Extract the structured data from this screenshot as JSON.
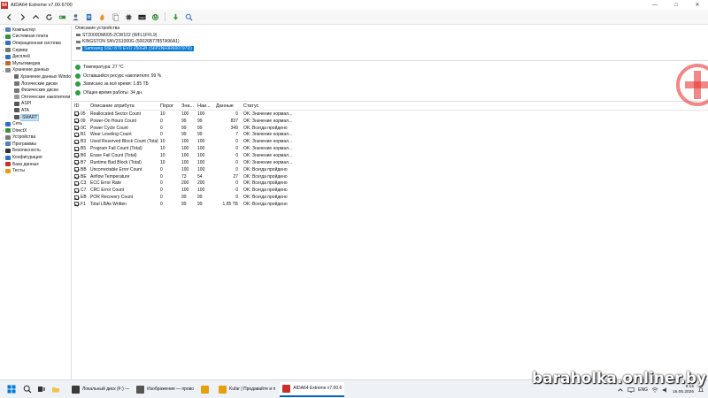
{
  "window": {
    "title": "AIDA64 Extreme v7.00.6700",
    "logo_text": "64"
  },
  "toolbar": {
    "buttons": [
      "back-icon",
      "forward-icon",
      "up-icon",
      "refresh-icon",
      "motherboard-icon",
      "user-icon",
      "report-icon",
      "favorites-icon",
      "folder-icon",
      "chip-icon",
      "osd-icon",
      "power-icon",
      "download-icon",
      "search-icon"
    ]
  },
  "sidebar": {
    "items": [
      {
        "label": "Компьютер",
        "exp": ">",
        "indent": 0
      },
      {
        "label": "Системная плата",
        "exp": ">",
        "indent": 0
      },
      {
        "label": "Операционная система",
        "exp": ">",
        "indent": 0
      },
      {
        "label": "Сервер",
        "exp": ">",
        "indent": 0
      },
      {
        "label": "Дисплей",
        "exp": ">",
        "indent": 0
      },
      {
        "label": "Мультимедиа",
        "exp": ">",
        "indent": 0
      },
      {
        "label": "Хранение данных",
        "exp": "v",
        "indent": 0
      },
      {
        "label": "Хранение данных Windo",
        "exp": "",
        "indent": 1
      },
      {
        "label": "Логические диски",
        "exp": "",
        "indent": 1
      },
      {
        "label": "Физические диски",
        "exp": "",
        "indent": 1
      },
      {
        "label": "Оптические накопители",
        "exp": "",
        "indent": 1
      },
      {
        "label": "ASPI",
        "exp": "",
        "indent": 1
      },
      {
        "label": "ATA",
        "exp": "",
        "indent": 1
      },
      {
        "label": "SMART",
        "exp": "",
        "indent": 1,
        "selected": true
      },
      {
        "label": "Сеть",
        "exp": ">",
        "indent": 0
      },
      {
        "label": "DirectX",
        "exp": ">",
        "indent": 0
      },
      {
        "label": "Устройства",
        "exp": ">",
        "indent": 0
      },
      {
        "label": "Программы",
        "exp": ">",
        "indent": 0
      },
      {
        "label": "Безопасность",
        "exp": ">",
        "indent": 0
      },
      {
        "label": "Конфигурация",
        "exp": ">",
        "indent": 0
      },
      {
        "label": "База данных",
        "exp": ">",
        "indent": 0
      },
      {
        "label": "Тесты",
        "exp": ">",
        "indent": 0
      }
    ]
  },
  "devices": {
    "header": "Описание устройства",
    "items": [
      {
        "label": "ST2000DM005-2CW102 (WFL1FFL9)",
        "selected": false
      },
      {
        "label": "KINGSTON SNV2S1000G (50026B7785TA96A1)",
        "selected": false
      },
      {
        "label": "Samsung SSD 870 EVO 250GB (S6P2NF0R600797D)",
        "selected": true
      }
    ]
  },
  "info": [
    "Температура: 27 °C",
    "Оставшийся ресурс накопителя: 99 %",
    "Записано за всё время: 1.85 ТБ",
    "Общее время работы: 34 дн."
  ],
  "table": {
    "headers": {
      "id": "ID",
      "desc": "Описание атрибута",
      "thr": "Порог",
      "val": "Зна...",
      "worst": "Наи...",
      "data": "Данные",
      "status": "Статус"
    },
    "rows": [
      {
        "id": "05",
        "desc": "Reallocated Sector Count",
        "thr": "10",
        "val": "100",
        "worst": "100",
        "data": "0",
        "status": "OK: Значение нормал..."
      },
      {
        "id": "09",
        "desc": "Power-On Hours Count",
        "thr": "0",
        "val": "99",
        "worst": "99",
        "data": "837",
        "status": "OK: Значение нормал..."
      },
      {
        "id": "0C",
        "desc": "Power Cycle Count",
        "thr": "0",
        "val": "99",
        "worst": "99",
        "data": "349",
        "status": "OK: Всегда пройдено"
      },
      {
        "id": "B1",
        "desc": "Wear Leveling Count",
        "thr": "0",
        "val": "99",
        "worst": "99",
        "data": "7",
        "status": "OK: Значение нормал..."
      },
      {
        "id": "B3",
        "desc": "Used Reserved Block Count (Total)",
        "thr": "10",
        "val": "100",
        "worst": "100",
        "data": "0",
        "status": "OK: Значение нормал..."
      },
      {
        "id": "B5",
        "desc": "Program Fail Count (Total)",
        "thr": "10",
        "val": "100",
        "worst": "100",
        "data": "0",
        "status": "OK: Значение нормал..."
      },
      {
        "id": "B6",
        "desc": "Erase Fail Count (Total)",
        "thr": "10",
        "val": "100",
        "worst": "100",
        "data": "0",
        "status": "OK: Значение нормал..."
      },
      {
        "id": "B7",
        "desc": "Runtime Bad Block (Total)",
        "thr": "10",
        "val": "100",
        "worst": "100",
        "data": "0",
        "status": "OK: Значение нормал..."
      },
      {
        "id": "BB",
        "desc": "Uncorrectable Error Count",
        "thr": "0",
        "val": "100",
        "worst": "100",
        "data": "0",
        "status": "OK: Всегда пройдено"
      },
      {
        "id": "BE",
        "desc": "Airflow Temperature",
        "thr": "0",
        "val": "73",
        "worst": "54",
        "data": "27",
        "status": "OK: Всегда пройдено"
      },
      {
        "id": "C3",
        "desc": "ECC Error Rate",
        "thr": "0",
        "val": "200",
        "worst": "200",
        "data": "0",
        "status": "OK: Всегда пройдено"
      },
      {
        "id": "C7",
        "desc": "CRC Error Count",
        "thr": "0",
        "val": "100",
        "worst": "100",
        "data": "0",
        "status": "OK: Всегда пройдено"
      },
      {
        "id": "EB",
        "desc": "POR Recovery Count",
        "thr": "0",
        "val": "99",
        "worst": "99",
        "data": "9",
        "status": "OK: Всегда пройдено"
      },
      {
        "id": "F1",
        "desc": "Total LBAs Written",
        "thr": "0",
        "val": "99",
        "worst": "99",
        "data": "1.85 ТБ",
        "status": "OK: Всегда пройдено"
      }
    ]
  },
  "taskbar": {
    "apps": [
      {
        "label": "Локальный диск (F:) —",
        "icon": "explorer-icon",
        "color": "#3a3a3a"
      },
      {
        "label": "Изображения — прово",
        "icon": "gallery-icon",
        "color": "#555"
      },
      {
        "label": "",
        "icon": "chrome-icon",
        "color": "#e5a00d"
      },
      {
        "label": "Kufar | Продавайте и п",
        "icon": "chrome-icon",
        "color": "#e5a00d"
      },
      {
        "label": "AIDA64 Extreme v7.00.6",
        "icon": "aida-icon",
        "color": "#c9302c",
        "active": true
      }
    ],
    "tray": {
      "lang": "ENG",
      "time": "8:15",
      "date": "16.05.2026"
    }
  },
  "watermark": "baraholka.onliner.by",
  "colors": {
    "ok": "#2ea043",
    "selection": "#0078d7",
    "accent_red": "#e53935"
  }
}
